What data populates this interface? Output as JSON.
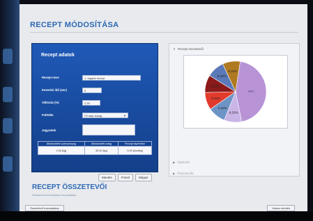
{
  "page": {
    "title": "RECEPT MÓDOSÍTÁSA"
  },
  "form": {
    "title": "Recept adatok",
    "fields": [
      {
        "label": "Recept neve",
        "value": "1. fogadó recept",
        "w": 84
      },
      {
        "label": "Keverési idő (sec)",
        "value": "0",
        "w": 28
      },
      {
        "label": "Változás (%)",
        "value": "2,33",
        "w": 26
      },
      {
        "label": "Folttölto",
        "value": "Fő alap anyag",
        "w": 66,
        "select": true
      },
      {
        "label": "Jegyzetek",
        "value": "",
        "w": 76,
        "tall": true
      }
    ],
    "results_headers": [
      "Átlaskoktett szárazanyag",
      "Átlaskoktett adag",
      "Recept tápértéke"
    ],
    "results_values": [
      "2,00 [kg]",
      "30,00 [kg]",
      "0,00 [kcal/kg]"
    ]
  },
  "buttons": {
    "save": "Mentés",
    "refresh": "Frissít",
    "cancel": "Mégse"
  },
  "right": {
    "accordion_open": "Recept összetevői",
    "accordion_closed_1": "Tápérték",
    "accordion_closed_2": "Összetevők"
  },
  "pie_labels": [
    "40%",
    "8,33%",
    "8,33%",
    "8,33%",
    "8,33%",
    "8,33%",
    "8,33%"
  ],
  "section2": {
    "title": "RECEPT ÖSSZETEVŐI",
    "subtitle": "Összetevő módosítása hozzáadása"
  },
  "bottom": {
    "left_button": "Összetevő hozzáadása",
    "right_button": "Vissza mentés"
  },
  "colors": {
    "accent": "#2d68b3",
    "panel_blue": "#1a4fa3",
    "pie": [
      "#b894d6",
      "#c9b5e6",
      "#6e94c6",
      "#e23b2c",
      "#8b1a1a",
      "#5a79b8",
      "#b07a22"
    ]
  },
  "chart_data": {
    "type": "pie",
    "labels": [
      "",
      "",
      "",
      "",
      "",
      "",
      ""
    ],
    "values": [
      40,
      8.33,
      8.33,
      8.33,
      8.33,
      8.33,
      8.33
    ],
    "title": ""
  }
}
